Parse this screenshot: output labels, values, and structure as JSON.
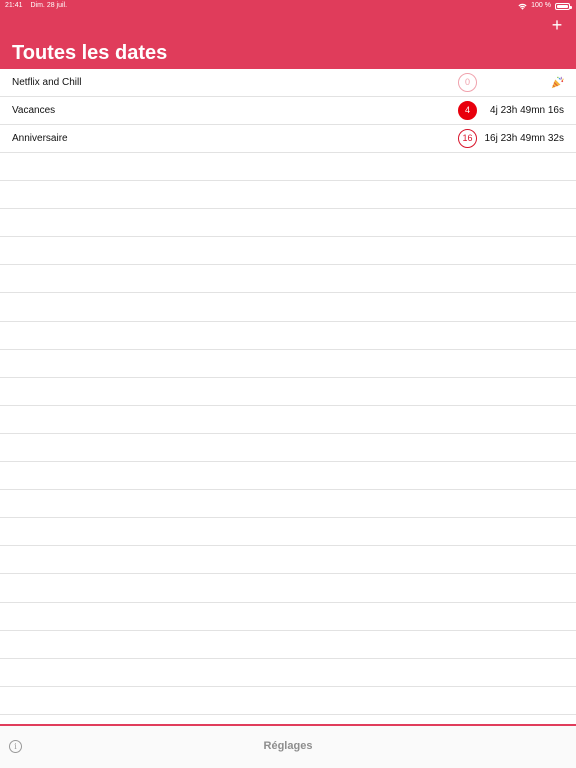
{
  "status_bar": {
    "time": "21:41",
    "date": "Dim. 28 juil.",
    "battery": "100 %"
  },
  "header": {
    "title": "Toutes les dates",
    "add_label": "+"
  },
  "events": [
    {
      "title": "Netflix and Chill",
      "days": "0",
      "countdown": ""
    },
    {
      "title": "Vacances",
      "days": "4",
      "countdown": "4j 23h 49mn 16s"
    },
    {
      "title": "Anniversaire",
      "days": "16",
      "countdown": "16j 23h 49mn 32s"
    }
  ],
  "footer": {
    "info_label": "i",
    "settings_label": "Réglages"
  },
  "colors": {
    "accent": "#e03c5b",
    "badge_red": "#e8000d"
  },
  "icons": {
    "party": "party-popper-icon",
    "info": "info-icon",
    "wifi": "wifi-icon",
    "battery": "battery-icon",
    "add": "plus-icon"
  }
}
